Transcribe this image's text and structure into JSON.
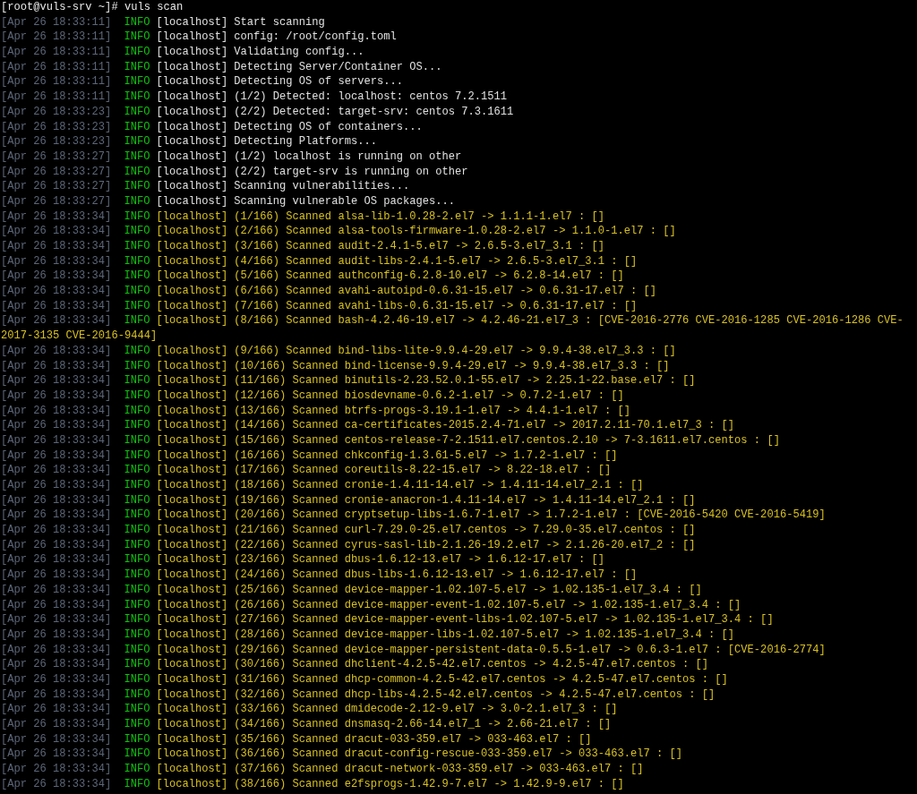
{
  "terminal": {
    "lines": [
      {
        "kind": "prompt",
        "text": "[root@vuls-srv ~]# vuls scan"
      },
      {
        "kind": "status",
        "time": "[Apr 26 18:33:11]",
        "level": "INFO",
        "host": "[localhost]",
        "message": "Start scanning"
      },
      {
        "kind": "status",
        "time": "[Apr 26 18:33:11]",
        "level": "INFO",
        "host": "[localhost]",
        "message": "config: /root/config.toml"
      },
      {
        "kind": "status",
        "time": "[Apr 26 18:33:11]",
        "level": "INFO",
        "host": "[localhost]",
        "message": "Validating config..."
      },
      {
        "kind": "status",
        "time": "[Apr 26 18:33:11]",
        "level": "INFO",
        "host": "[localhost]",
        "message": "Detecting Server/Container OS..."
      },
      {
        "kind": "status",
        "time": "[Apr 26 18:33:11]",
        "level": "INFO",
        "host": "[localhost]",
        "message": "Detecting OS of servers..."
      },
      {
        "kind": "status",
        "time": "[Apr 26 18:33:11]",
        "level": "INFO",
        "host": "[localhost]",
        "message": "(1/2) Detected: localhost: centos 7.2.1511"
      },
      {
        "kind": "status",
        "time": "[Apr 26 18:33:23]",
        "level": "INFO",
        "host": "[localhost]",
        "message": "(2/2) Detected: target-srv: centos 7.3.1611"
      },
      {
        "kind": "status",
        "time": "[Apr 26 18:33:23]",
        "level": "INFO",
        "host": "[localhost]",
        "message": "Detecting OS of containers..."
      },
      {
        "kind": "status",
        "time": "[Apr 26 18:33:23]",
        "level": "INFO",
        "host": "[localhost]",
        "message": "Detecting Platforms..."
      },
      {
        "kind": "status",
        "time": "[Apr 26 18:33:27]",
        "level": "INFO",
        "host": "[localhost]",
        "message": "(1/2) localhost is running on other"
      },
      {
        "kind": "status",
        "time": "[Apr 26 18:33:27]",
        "level": "INFO",
        "host": "[localhost]",
        "message": "(2/2) target-srv is running on other"
      },
      {
        "kind": "status",
        "time": "[Apr 26 18:33:27]",
        "level": "INFO",
        "host": "[localhost]",
        "message": "Scanning vulnerabilities..."
      },
      {
        "kind": "status",
        "time": "[Apr 26 18:33:27]",
        "level": "INFO",
        "host": "[localhost]",
        "message": "Scanning vulnerable OS packages..."
      },
      {
        "kind": "result",
        "time": "[Apr 26 18:33:34]",
        "level": "INFO",
        "host": "[localhost]",
        "message": "(1/166) Scanned alsa-lib-1.0.28-2.el7 -> 1.1.1-1.el7 : []"
      },
      {
        "kind": "result",
        "time": "[Apr 26 18:33:34]",
        "level": "INFO",
        "host": "[localhost]",
        "message": "(2/166) Scanned alsa-tools-firmware-1.0.28-2.el7 -> 1.1.0-1.el7 : []"
      },
      {
        "kind": "result",
        "time": "[Apr 26 18:33:34]",
        "level": "INFO",
        "host": "[localhost]",
        "message": "(3/166) Scanned audit-2.4.1-5.el7 -> 2.6.5-3.el7_3.1 : []"
      },
      {
        "kind": "result",
        "time": "[Apr 26 18:33:34]",
        "level": "INFO",
        "host": "[localhost]",
        "message": "(4/166) Scanned audit-libs-2.4.1-5.el7 -> 2.6.5-3.el7_3.1 : []"
      },
      {
        "kind": "result",
        "time": "[Apr 26 18:33:34]",
        "level": "INFO",
        "host": "[localhost]",
        "message": "(5/166) Scanned authconfig-6.2.8-10.el7 -> 6.2.8-14.el7 : []"
      },
      {
        "kind": "result",
        "time": "[Apr 26 18:33:34]",
        "level": "INFO",
        "host": "[localhost]",
        "message": "(6/166) Scanned avahi-autoipd-0.6.31-15.el7 -> 0.6.31-17.el7 : []"
      },
      {
        "kind": "result",
        "time": "[Apr 26 18:33:34]",
        "level": "INFO",
        "host": "[localhost]",
        "message": "(7/166) Scanned avahi-libs-0.6.31-15.el7 -> 0.6.31-17.el7 : []"
      },
      {
        "kind": "result",
        "time": "[Apr 26 18:33:34]",
        "level": "INFO",
        "host": "[localhost]",
        "message": "(8/166) Scanned bash-4.2.46-19.el7 -> 4.2.46-21.el7_3 : [CVE-2016-2776 CVE-2016-1285 CVE-2016-1286 CVE-"
      },
      {
        "kind": "wrap",
        "text": "2017-3135 CVE-2016-9444]"
      },
      {
        "kind": "result",
        "time": "[Apr 26 18:33:34]",
        "level": "INFO",
        "host": "[localhost]",
        "message": "(9/166) Scanned bind-libs-lite-9.9.4-29.el7 -> 9.9.4-38.el7_3.3 : []"
      },
      {
        "kind": "result",
        "time": "[Apr 26 18:33:34]",
        "level": "INFO",
        "host": "[localhost]",
        "message": "(10/166) Scanned bind-license-9.9.4-29.el7 -> 9.9.4-38.el7_3.3 : []"
      },
      {
        "kind": "result",
        "time": "[Apr 26 18:33:34]",
        "level": "INFO",
        "host": "[localhost]",
        "message": "(11/166) Scanned binutils-2.23.52.0.1-55.el7 -> 2.25.1-22.base.el7 : []"
      },
      {
        "kind": "result",
        "time": "[Apr 26 18:33:34]",
        "level": "INFO",
        "host": "[localhost]",
        "message": "(12/166) Scanned biosdevname-0.6.2-1.el7 -> 0.7.2-1.el7 : []"
      },
      {
        "kind": "result",
        "time": "[Apr 26 18:33:34]",
        "level": "INFO",
        "host": "[localhost]",
        "message": "(13/166) Scanned btrfs-progs-3.19.1-1.el7 -> 4.4.1-1.el7 : []"
      },
      {
        "kind": "result",
        "time": "[Apr 26 18:33:34]",
        "level": "INFO",
        "host": "[localhost]",
        "message": "(14/166) Scanned ca-certificates-2015.2.4-71.el7 -> 2017.2.11-70.1.el7_3 : []"
      },
      {
        "kind": "result",
        "time": "[Apr 26 18:33:34]",
        "level": "INFO",
        "host": "[localhost]",
        "message": "(15/166) Scanned centos-release-7-2.1511.el7.centos.2.10 -> 7-3.1611.el7.centos : []"
      },
      {
        "kind": "result",
        "time": "[Apr 26 18:33:34]",
        "level": "INFO",
        "host": "[localhost]",
        "message": "(16/166) Scanned chkconfig-1.3.61-5.el7 -> 1.7.2-1.el7 : []"
      },
      {
        "kind": "result",
        "time": "[Apr 26 18:33:34]",
        "level": "INFO",
        "host": "[localhost]",
        "message": "(17/166) Scanned coreutils-8.22-15.el7 -> 8.22-18.el7 : []"
      },
      {
        "kind": "result",
        "time": "[Apr 26 18:33:34]",
        "level": "INFO",
        "host": "[localhost]",
        "message": "(18/166) Scanned cronie-1.4.11-14.el7 -> 1.4.11-14.el7_2.1 : []"
      },
      {
        "kind": "result",
        "time": "[Apr 26 18:33:34]",
        "level": "INFO",
        "host": "[localhost]",
        "message": "(19/166) Scanned cronie-anacron-1.4.11-14.el7 -> 1.4.11-14.el7_2.1 : []"
      },
      {
        "kind": "result",
        "time": "[Apr 26 18:33:34]",
        "level": "INFO",
        "host": "[localhost]",
        "message": "(20/166) Scanned cryptsetup-libs-1.6.7-1.el7 -> 1.7.2-1.el7 : [CVE-2016-5420 CVE-2016-5419]"
      },
      {
        "kind": "result",
        "time": "[Apr 26 18:33:34]",
        "level": "INFO",
        "host": "[localhost]",
        "message": "(21/166) Scanned curl-7.29.0-25.el7.centos -> 7.29.0-35.el7.centos : []"
      },
      {
        "kind": "result",
        "time": "[Apr 26 18:33:34]",
        "level": "INFO",
        "host": "[localhost]",
        "message": "(22/166) Scanned cyrus-sasl-lib-2.1.26-19.2.el7 -> 2.1.26-20.el7_2 : []"
      },
      {
        "kind": "result",
        "time": "[Apr 26 18:33:34]",
        "level": "INFO",
        "host": "[localhost]",
        "message": "(23/166) Scanned dbus-1.6.12-13.el7 -> 1.6.12-17.el7 : []"
      },
      {
        "kind": "result",
        "time": "[Apr 26 18:33:34]",
        "level": "INFO",
        "host": "[localhost]",
        "message": "(24/166) Scanned dbus-libs-1.6.12-13.el7 -> 1.6.12-17.el7 : []"
      },
      {
        "kind": "result",
        "time": "[Apr 26 18:33:34]",
        "level": "INFO",
        "host": "[localhost]",
        "message": "(25/166) Scanned device-mapper-1.02.107-5.el7 -> 1.02.135-1.el7_3.4 : []"
      },
      {
        "kind": "result",
        "time": "[Apr 26 18:33:34]",
        "level": "INFO",
        "host": "[localhost]",
        "message": "(26/166) Scanned device-mapper-event-1.02.107-5.el7 -> 1.02.135-1.el7_3.4 : []"
      },
      {
        "kind": "result",
        "time": "[Apr 26 18:33:34]",
        "level": "INFO",
        "host": "[localhost]",
        "message": "(27/166) Scanned device-mapper-event-libs-1.02.107-5.el7 -> 1.02.135-1.el7_3.4 : []"
      },
      {
        "kind": "result",
        "time": "[Apr 26 18:33:34]",
        "level": "INFO",
        "host": "[localhost]",
        "message": "(28/166) Scanned device-mapper-libs-1.02.107-5.el7 -> 1.02.135-1.el7_3.4 : []"
      },
      {
        "kind": "result",
        "time": "[Apr 26 18:33:34]",
        "level": "INFO",
        "host": "[localhost]",
        "message": "(29/166) Scanned device-mapper-persistent-data-0.5.5-1.el7 -> 0.6.3-1.el7 : [CVE-2016-2774]"
      },
      {
        "kind": "result",
        "time": "[Apr 26 18:33:34]",
        "level": "INFO",
        "host": "[localhost]",
        "message": "(30/166) Scanned dhclient-4.2.5-42.el7.centos -> 4.2.5-47.el7.centos : []"
      },
      {
        "kind": "result",
        "time": "[Apr 26 18:33:34]",
        "level": "INFO",
        "host": "[localhost]",
        "message": "(31/166) Scanned dhcp-common-4.2.5-42.el7.centos -> 4.2.5-47.el7.centos : []"
      },
      {
        "kind": "result",
        "time": "[Apr 26 18:33:34]",
        "level": "INFO",
        "host": "[localhost]",
        "message": "(32/166) Scanned dhcp-libs-4.2.5-42.el7.centos -> 4.2.5-47.el7.centos : []"
      },
      {
        "kind": "result",
        "time": "[Apr 26 18:33:34]",
        "level": "INFO",
        "host": "[localhost]",
        "message": "(33/166) Scanned dmidecode-2.12-9.el7 -> 3.0-2.1.el7_3 : []"
      },
      {
        "kind": "result",
        "time": "[Apr 26 18:33:34]",
        "level": "INFO",
        "host": "[localhost]",
        "message": "(34/166) Scanned dnsmasq-2.66-14.el7_1 -> 2.66-21.el7 : []"
      },
      {
        "kind": "result",
        "time": "[Apr 26 18:33:34]",
        "level": "INFO",
        "host": "[localhost]",
        "message": "(35/166) Scanned dracut-033-359.el7 -> 033-463.el7 : []"
      },
      {
        "kind": "result",
        "time": "[Apr 26 18:33:34]",
        "level": "INFO",
        "host": "[localhost]",
        "message": "(36/166) Scanned dracut-config-rescue-033-359.el7 -> 033-463.el7 : []"
      },
      {
        "kind": "result",
        "time": "[Apr 26 18:33:34]",
        "level": "INFO",
        "host": "[localhost]",
        "message": "(37/166) Scanned dracut-network-033-359.el7 -> 033-463.el7 : []"
      },
      {
        "kind": "result",
        "time": "[Apr 26 18:33:34]",
        "level": "INFO",
        "host": "[localhost]",
        "message": "(38/166) Scanned e2fsprogs-1.42.9-7.el7 -> 1.42.9-9.el7 : []"
      }
    ]
  }
}
